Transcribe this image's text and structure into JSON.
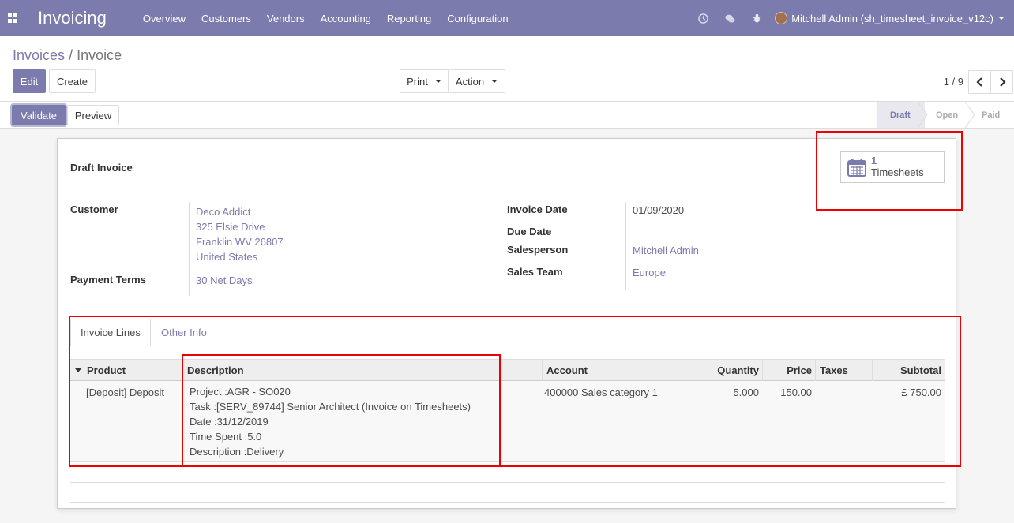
{
  "navbar": {
    "brand": "Invoicing",
    "menu": [
      "Overview",
      "Customers",
      "Vendors",
      "Accounting",
      "Reporting",
      "Configuration"
    ],
    "user": "Mitchell Admin (sh_timesheet_invoice_v12c)"
  },
  "breadcrumb": {
    "parent": "Invoices",
    "separator": "/",
    "current": "Invoice"
  },
  "toolbar": {
    "edit": "Edit",
    "create": "Create",
    "print": "Print",
    "action": "Action",
    "pager": "1 / 9"
  },
  "statusbar": {
    "validate": "Validate",
    "preview": "Preview",
    "stages": [
      "Draft",
      "Open",
      "Paid"
    ],
    "active_stage": "Draft"
  },
  "sheet": {
    "title": "Draft Invoice",
    "smart_button": {
      "count": "1",
      "label": "Timesheets"
    },
    "customer_label": "Customer",
    "customer_lines": [
      "Deco Addict",
      "325 Elsie Drive",
      "Franklin WV 26807",
      "United States"
    ],
    "payment_terms_label": "Payment Terms",
    "payment_terms": "30 Net Days",
    "invoice_date_label": "Invoice Date",
    "invoice_date": "01/09/2020",
    "due_date_label": "Due Date",
    "salesperson_label": "Salesperson",
    "salesperson": "Mitchell Admin",
    "sales_team_label": "Sales Team",
    "sales_team": "Europe"
  },
  "tabs": [
    "Invoice Lines",
    "Other Info"
  ],
  "table": {
    "columns": [
      "Product",
      "Description",
      "Account",
      "Quantity",
      "Price",
      "Taxes",
      "Subtotal"
    ],
    "rows": [
      {
        "product": "[Deposit] Deposit",
        "description": [
          "Project :AGR - SO020",
          "Task :[SERV_89744] Senior Architect (Invoice on Timesheets)",
          "Date :31/12/2019",
          "Time Spent :5.0",
          "Description :Delivery"
        ],
        "account": "400000 Sales category 1",
        "quantity": "5.000",
        "price": "150.00",
        "taxes": "",
        "subtotal": "£ 750.00"
      }
    ]
  },
  "colors": {
    "brand": "#7c7bad",
    "highlight": "#ee0000"
  },
  "icons": [
    "apps-icon",
    "clock-icon",
    "chat-icon",
    "bug-icon",
    "calendar-icon",
    "chevron-left-icon",
    "chevron-right-icon"
  ]
}
